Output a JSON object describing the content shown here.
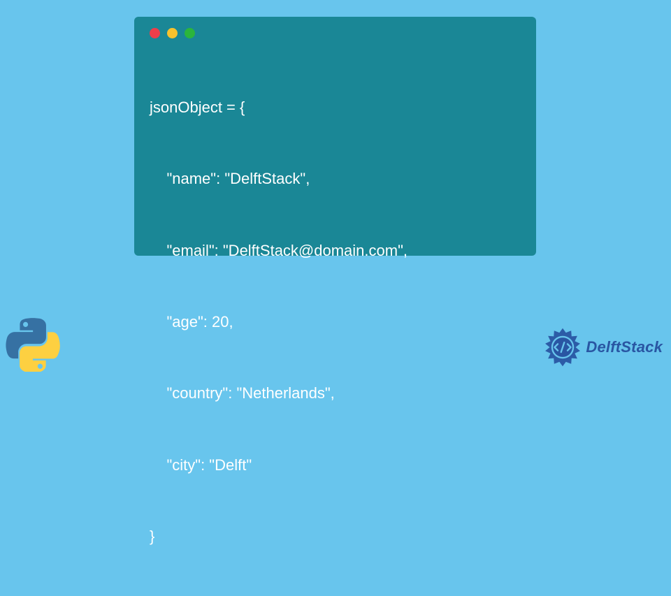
{
  "code": {
    "lines": [
      "jsonObject = {",
      "    \"name\": \"DelftStack\",",
      "    \"email\": \"DelftStack@domain.com\",",
      "    \"age\": 20,",
      "    \"country\": \"Netherlands\",",
      "    \"city\": \"Delft\"",
      "}"
    ]
  },
  "window": {
    "dots": {
      "red": "#ed3e4a",
      "yellow": "#f7c22d",
      "green": "#2bb53c"
    }
  },
  "brand": {
    "name": "DelftStack"
  }
}
